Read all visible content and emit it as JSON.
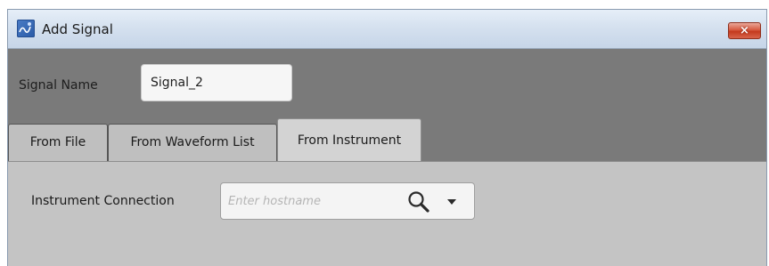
{
  "window": {
    "title": "Add Signal",
    "close_glyph": "×"
  },
  "signal_name": {
    "label": "Signal Name",
    "value": "Signal_2"
  },
  "tabs": [
    {
      "label": "From File",
      "selected": false
    },
    {
      "label": "From Waveform List",
      "selected": false
    },
    {
      "label": "From Instrument",
      "selected": true
    }
  ],
  "instrument": {
    "label": "Instrument Connection",
    "value": "",
    "placeholder": "Enter hostname"
  },
  "icons": {
    "app": "app-icon",
    "close": "close-icon",
    "search": "search-icon",
    "dropdown": "chevron-down-icon"
  }
}
